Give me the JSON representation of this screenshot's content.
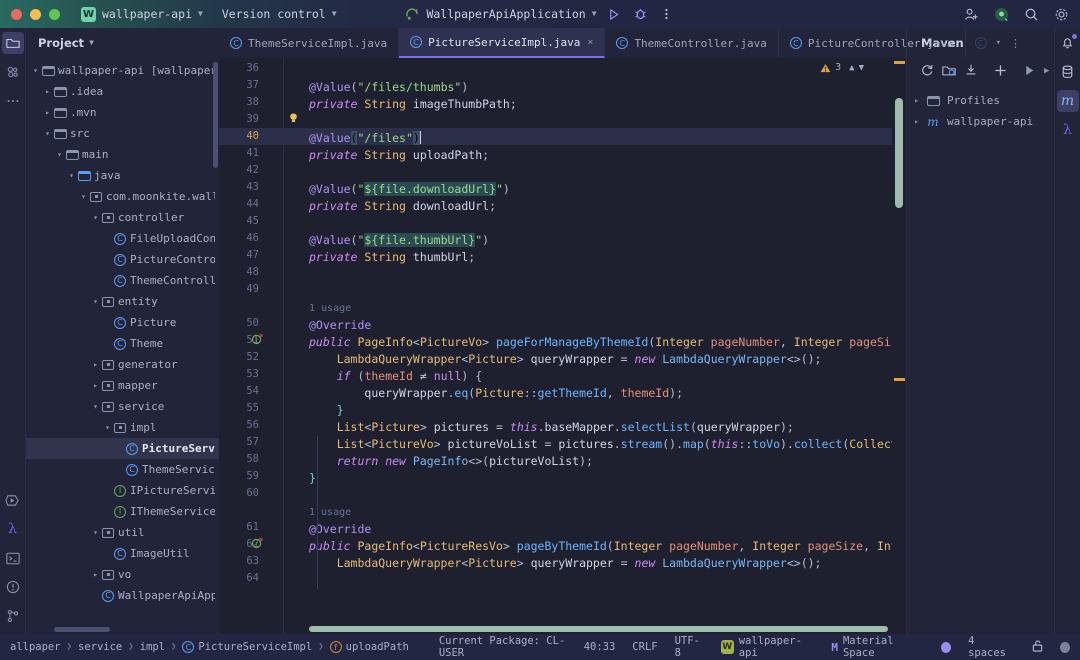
{
  "titlebar": {
    "project_badge": "W",
    "project_name": "wallpaper-api",
    "vcs_label": "Version control",
    "run_config": "WallpaperApiApplication",
    "run_icon": "run-icon",
    "debug_icon": "debug-icon",
    "more_icon": "more-vertical-icon",
    "account_icon": "add-account-icon",
    "ai_icon": "ai-assistant-icon",
    "search_icon": "search-icon",
    "settings_icon": "gear-icon"
  },
  "left_rail": {
    "top": [
      {
        "name": "project-tool-icon",
        "glyph": "folder"
      },
      {
        "name": "commit-tool-icon",
        "glyph": "commit"
      },
      {
        "name": "more-tools-icon",
        "glyph": "dots"
      }
    ],
    "bottom": [
      {
        "name": "run-tool-icon",
        "glyph": "run"
      },
      {
        "name": "lambda-tool-icon",
        "glyph": "lambda"
      },
      {
        "name": "terminal-tool-icon",
        "glyph": "terminal"
      },
      {
        "name": "problems-tool-icon",
        "glyph": "problems"
      },
      {
        "name": "version-control-tool-icon",
        "glyph": "branch"
      }
    ]
  },
  "project_panel": {
    "title": "Project",
    "tree": [
      {
        "indent": 0,
        "arrow": "v",
        "icon": "module",
        "label": "wallpaper-api [wallpaper]",
        "selected": false
      },
      {
        "indent": 1,
        "arrow": ">",
        "icon": "folder",
        "label": ".idea",
        "selected": false
      },
      {
        "indent": 1,
        "arrow": ">",
        "icon": "folder",
        "label": ".mvn",
        "selected": false
      },
      {
        "indent": 1,
        "arrow": "v",
        "icon": "folder",
        "label": "src",
        "selected": false
      },
      {
        "indent": 2,
        "arrow": "v",
        "icon": "folder",
        "label": "main",
        "selected": false
      },
      {
        "indent": 3,
        "arrow": "v",
        "icon": "folder-blue",
        "label": "java",
        "selected": false
      },
      {
        "indent": 4,
        "arrow": "v",
        "icon": "package",
        "label": "com.moonkite.wallp",
        "selected": false
      },
      {
        "indent": 5,
        "arrow": "v",
        "icon": "package",
        "label": "controller",
        "selected": false
      },
      {
        "indent": 6,
        "arrow": "",
        "icon": "class",
        "label": "FileUploadCont",
        "selected": false
      },
      {
        "indent": 6,
        "arrow": "",
        "icon": "class",
        "label": "PictureControl",
        "selected": false
      },
      {
        "indent": 6,
        "arrow": "",
        "icon": "class",
        "label": "ThemeControlle",
        "selected": false
      },
      {
        "indent": 5,
        "arrow": "v",
        "icon": "package",
        "label": "entity",
        "selected": false
      },
      {
        "indent": 6,
        "arrow": "",
        "icon": "class",
        "label": "Picture",
        "selected": false
      },
      {
        "indent": 6,
        "arrow": "",
        "icon": "class",
        "label": "Theme",
        "selected": false
      },
      {
        "indent": 5,
        "arrow": ">",
        "icon": "package",
        "label": "generator",
        "selected": false
      },
      {
        "indent": 5,
        "arrow": ">",
        "icon": "package",
        "label": "mapper",
        "selected": false
      },
      {
        "indent": 5,
        "arrow": "v",
        "icon": "package",
        "label": "service",
        "selected": false
      },
      {
        "indent": 6,
        "arrow": "v",
        "icon": "package",
        "label": "impl",
        "selected": false
      },
      {
        "indent": 7,
        "arrow": "",
        "icon": "class",
        "label": "PictureServi",
        "selected": true
      },
      {
        "indent": 7,
        "arrow": "",
        "icon": "class",
        "label": "ThemeService",
        "selected": false
      },
      {
        "indent": 6,
        "arrow": "",
        "icon": "interface",
        "label": "IPictureServic",
        "selected": false
      },
      {
        "indent": 6,
        "arrow": "",
        "icon": "interface",
        "label": "IThemeService",
        "selected": false
      },
      {
        "indent": 5,
        "arrow": "v",
        "icon": "package",
        "label": "util",
        "selected": false
      },
      {
        "indent": 6,
        "arrow": "",
        "icon": "class",
        "label": "ImageUtil",
        "selected": false
      },
      {
        "indent": 5,
        "arrow": ">",
        "icon": "package",
        "label": "vo",
        "selected": false
      },
      {
        "indent": 5,
        "arrow": "",
        "icon": "spring-class",
        "label": "WallpaperApiAppl",
        "selected": false
      }
    ]
  },
  "editor": {
    "tabs": [
      {
        "label": "ThemeServiceImpl.java",
        "active": false,
        "closable": false
      },
      {
        "label": "PictureServiceImpl.java",
        "active": true,
        "closable": true
      },
      {
        "label": "ThemeController.java",
        "active": false,
        "closable": false
      },
      {
        "label": "PictureController.java",
        "active": false,
        "closable": false
      }
    ],
    "tabs_overflow_icon": "chevron-down-icon",
    "tabs_more_icon": "more-vertical-icon",
    "warning_count": "3",
    "warning_icon": "warning-triangle-icon",
    "prev_error_icon": "chevron-up-icon",
    "next_error_icon": "chevron-down-icon",
    "current_line": 40,
    "lines": [
      {
        "n": 36,
        "text": ""
      },
      {
        "n": 37,
        "text": "@Value(\"/files/thumbs\")"
      },
      {
        "n": 38,
        "text": "private String imageThumbPath;"
      },
      {
        "n": 39,
        "text": "",
        "gutter_icon": "intention-bulb-icon"
      },
      {
        "n": 40,
        "text": "@Value(\"/files\")",
        "current": true
      },
      {
        "n": 41,
        "text": "private String uploadPath;"
      },
      {
        "n": 42,
        "text": ""
      },
      {
        "n": 43,
        "text": "@Value(\"${file.downloadUrl}\")"
      },
      {
        "n": 44,
        "text": "private String downloadUrl;"
      },
      {
        "n": 45,
        "text": ""
      },
      {
        "n": 46,
        "text": "@Value(\"${file.thumbUrl}\")"
      },
      {
        "n": 47,
        "text": "private String thumbUrl;"
      },
      {
        "n": 48,
        "text": ""
      },
      {
        "n": 49,
        "text": ""
      },
      {
        "n": null,
        "text": "1 usage",
        "hint": true
      },
      {
        "n": 50,
        "text": "@Override"
      },
      {
        "n": 51,
        "text": "public PageInfo<PictureVo> pageForManageByThemeId(Integer pageNumber, Integer pageSize, Integer themeId",
        "gutter_icon": "implementing-method-icon"
      },
      {
        "n": 52,
        "text": "    LambdaQueryWrapper<Picture> queryWrapper = new LambdaQueryWrapper<>();"
      },
      {
        "n": 53,
        "text": "    if (themeId != null) {"
      },
      {
        "n": 54,
        "text": "        queryWrapper.eq(Picture::getThemeId, themeId);"
      },
      {
        "n": 55,
        "text": "    }"
      },
      {
        "n": 56,
        "text": "    List<Picture> pictures = this.baseMapper.selectList(queryWrapper);"
      },
      {
        "n": 57,
        "text": "    List<PictureVo> pictureVoList = pictures.stream().map(this::toVo).collect(Collectors.toList());"
      },
      {
        "n": 58,
        "text": "    return new PageInfo<>(pictureVoList);"
      },
      {
        "n": 59,
        "text": "}"
      },
      {
        "n": 60,
        "text": ""
      },
      {
        "n": null,
        "text": "1 usage",
        "hint": true
      },
      {
        "n": 61,
        "text": "@Override"
      },
      {
        "n": 62,
        "text": "public PageInfo<PictureResVo> pageByThemeId(Integer pageNumber, Integer pageSize, Integer themeId) {",
        "gutter_icon": "implementing-method-icon"
      },
      {
        "n": 63,
        "text": "    LambdaQueryWrapper<Picture> queryWrapper = new LambdaQueryWrapper<>();"
      },
      {
        "n": 64,
        "text": ""
      }
    ]
  },
  "maven_panel": {
    "title": "Maven",
    "toolbar": [
      {
        "name": "reload-maven-icon"
      },
      {
        "name": "add-maven-project-icon"
      },
      {
        "name": "download-sources-icon"
      },
      {
        "name": "add-icon"
      },
      {
        "name": "run-maven-goal-icon"
      },
      {
        "name": "expand-icon"
      }
    ],
    "tree": [
      {
        "arrow": ">",
        "icon": "profiles-folder",
        "label": "Profiles"
      },
      {
        "arrow": ">",
        "icon": "maven-m",
        "label": "wallpaper-api"
      }
    ]
  },
  "right_rail": [
    {
      "name": "notifications-icon",
      "glyph": "bell",
      "badge": true
    },
    {
      "name": "database-icon",
      "glyph": "db",
      "badge": false
    },
    {
      "name": "maven-tool-icon",
      "glyph": "m",
      "badge": false,
      "active": true
    },
    {
      "name": "lambda-tool-icon",
      "glyph": "lambda",
      "badge": false
    }
  ],
  "status_bar": {
    "breadcrumbs": [
      {
        "label": "allpaper",
        "icon": null
      },
      {
        "label": "service",
        "icon": null
      },
      {
        "label": "impl",
        "icon": null
      },
      {
        "label": "PictureServiceImpl",
        "icon": "class-icon"
      },
      {
        "label": "uploadPath",
        "icon": "field-icon"
      }
    ],
    "current_package": "Current Package: CL-USER",
    "caret_position": "40:33",
    "line_separator": "CRLF",
    "encoding": "UTF-8",
    "project_badge": "W",
    "project_name": "wallpaper-api",
    "theme_icon": "material-icon",
    "theme_name": "Material Space",
    "indent": "4 spaces",
    "lock_icon": "unlocked-icon",
    "memory_icon": "status-circle-icon"
  },
  "colors": {
    "background": "#1e2030",
    "panel": "#22243a",
    "accent_purple": "#7a73e0",
    "selection": "#32344e",
    "current_line": "#2c2f4a",
    "string_green": "#9bd989",
    "keyword_purple": "#cf8bf3",
    "type_yellow": "#e6bc74",
    "method_blue": "#6cb6ff",
    "param_orange": "#e48f7a",
    "warning_yellow": "#d9a441"
  }
}
